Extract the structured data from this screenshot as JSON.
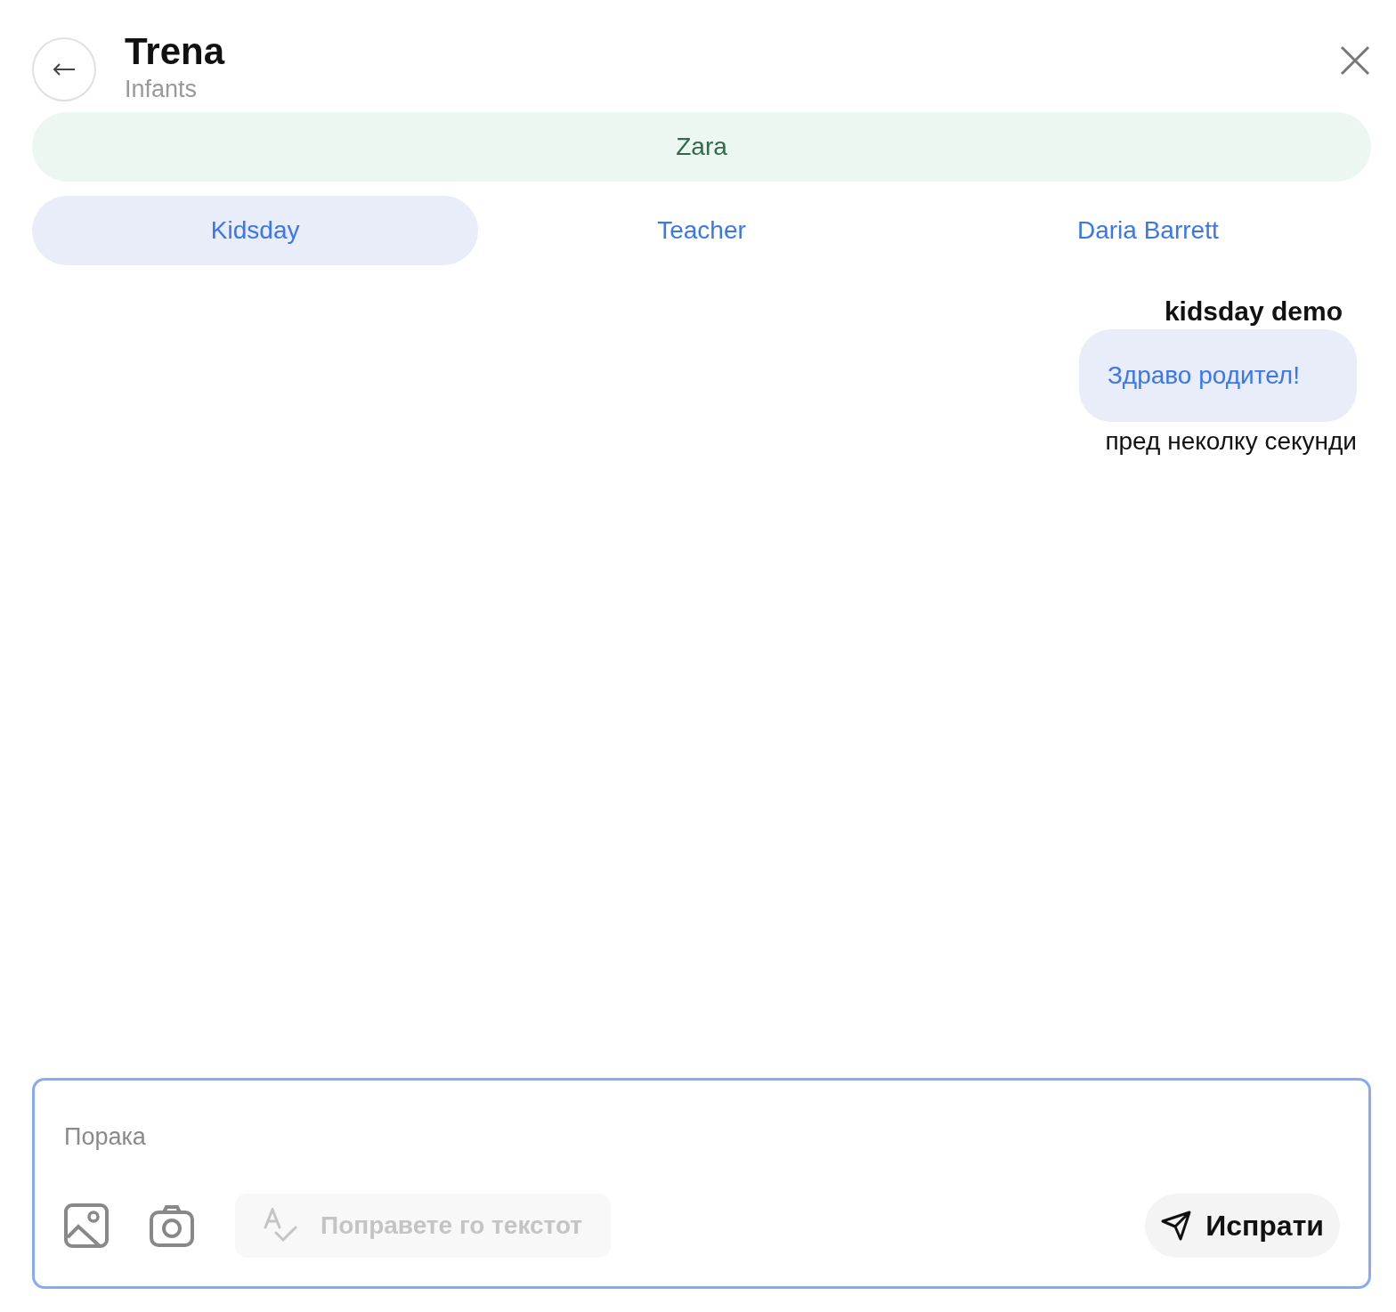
{
  "header": {
    "title": "Trena",
    "subtitle": "Infants"
  },
  "banner": {
    "label": "Zara"
  },
  "tabs": [
    {
      "label": "Kidsday",
      "selected": true
    },
    {
      "label": "Teacher",
      "selected": false
    },
    {
      "label": "Daria Barrett",
      "selected": false
    }
  ],
  "messages": [
    {
      "sender": "kidsday demo",
      "text": "Здраво родител!",
      "time": "пред неколку секунди"
    }
  ],
  "composer": {
    "placeholder": "Порака",
    "fix_text": {
      "label": "Поправете го текстот",
      "disabled": true
    },
    "send": {
      "label": "Испрати"
    }
  }
}
